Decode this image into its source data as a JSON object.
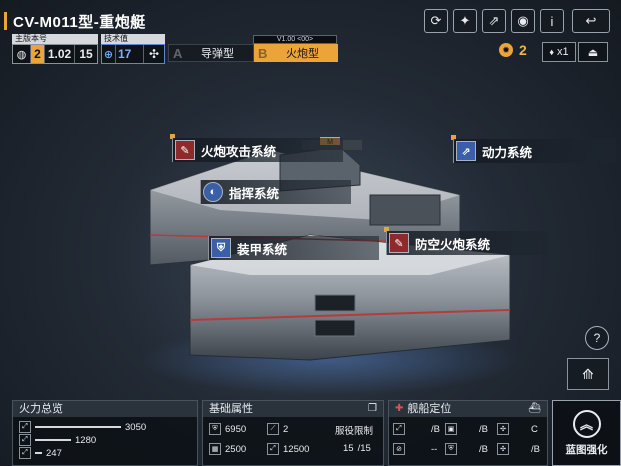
{
  "header": {
    "title": "CV-M011型-重炮艇",
    "icons": [
      "refresh-icon",
      "share-icon",
      "export-icon",
      "view-icon",
      "info-icon",
      "back-icon"
    ],
    "icon_glyphs": [
      "⟳",
      "✦",
      "⇗",
      "◉",
      "i",
      "↩"
    ]
  },
  "version": {
    "main_label": "主版本号",
    "main_value": "2",
    "version_number": "1.02",
    "version_sub": "15",
    "tech_label": "技术值",
    "tech_value": "17"
  },
  "tabs": [
    {
      "letter": "A",
      "label": "导弹型"
    },
    {
      "letter": "B",
      "label": "火炮型"
    }
  ],
  "version_tag": "V1.00 <00>",
  "currency": {
    "value": "2"
  },
  "quantity_label": "x1",
  "ship_marking": "M",
  "systems": [
    {
      "label": "火炮攻击系统"
    },
    {
      "label": "指挥系统"
    },
    {
      "label": "装甲系统"
    },
    {
      "label": "防空火炮系统"
    },
    {
      "label": "动力系统"
    }
  ],
  "firepower": {
    "title": "火力总览",
    "rows": [
      {
        "value": "3050"
      },
      {
        "value": "1280"
      },
      {
        "value": "247"
      }
    ]
  },
  "base_attrs": {
    "title": "基础属性",
    "armor": "6950",
    "slots": "2",
    "hp_a": "2500",
    "hp_b": "12500",
    "service_label": "服役限制",
    "service_value": "15",
    "service_max": "/15"
  },
  "positioning": {
    "title": "舰船定位",
    "cells": [
      {
        "value": "/B"
      },
      {
        "value": "/B"
      },
      {
        "value": "C"
      },
      {
        "value": "--"
      },
      {
        "value": "/B"
      },
      {
        "value": "/B"
      }
    ]
  },
  "strengthen": {
    "label": "蓝图强化"
  },
  "colors": {
    "accent": "#e9a43a",
    "red_icon": "#8e2a2a",
    "blue_icon": "#3a5fa8"
  }
}
